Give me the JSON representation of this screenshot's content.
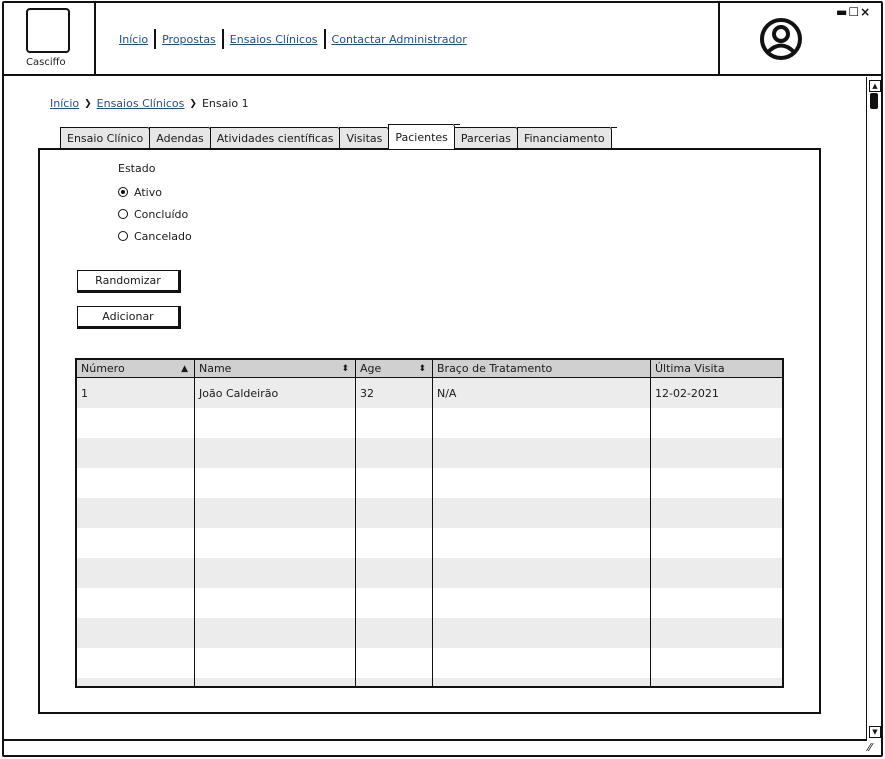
{
  "app": {
    "name": "Casciffo"
  },
  "topnav": {
    "items": [
      {
        "label": "Início"
      },
      {
        "label": "Propostas"
      },
      {
        "label": "Ensaios Clínicos"
      },
      {
        "label": "Contactar Administrador"
      }
    ]
  },
  "window_controls": {
    "label": "▬☐×"
  },
  "breadcrumb": {
    "items": [
      {
        "label": "Início"
      },
      {
        "label": "Ensaios Clínicos"
      },
      {
        "label": "Ensaio 1"
      }
    ],
    "separator": "❯"
  },
  "tabs": [
    {
      "label": "Ensaio Clínico"
    },
    {
      "label": "Adendas"
    },
    {
      "label": "Atividades científicas"
    },
    {
      "label": "Visitas"
    },
    {
      "label": "Pacientes",
      "active": true
    },
    {
      "label": "Parcerias"
    },
    {
      "label": "Financiamento"
    }
  ],
  "status": {
    "title": "Estado",
    "options": [
      {
        "label": "Ativo",
        "selected": true
      },
      {
        "label": "Concluído",
        "selected": false
      },
      {
        "label": "Cancelado",
        "selected": false
      }
    ]
  },
  "buttons": {
    "randomize": "Randomizar",
    "add": "Adicionar"
  },
  "table": {
    "columns": [
      {
        "label": "Número",
        "sort_icon": "▲"
      },
      {
        "label": "Name",
        "sort_icon": "⬍"
      },
      {
        "label": "Age",
        "sort_icon": "⬍"
      },
      {
        "label": "Braço de Tratamento",
        "sort_icon": ""
      },
      {
        "label": "Última Visita",
        "sort_icon": ""
      }
    ],
    "rows": [
      [
        "1",
        "João Caldeirão",
        "32",
        "N/A",
        "12-02-2021"
      ],
      [
        "",
        "",
        "",
        "",
        ""
      ],
      [
        "",
        "",
        "",
        "",
        ""
      ],
      [
        "",
        "",
        "",
        "",
        ""
      ],
      [
        "",
        "",
        "",
        "",
        ""
      ],
      [
        "",
        "",
        "",
        "",
        ""
      ],
      [
        "",
        "",
        "",
        "",
        ""
      ],
      [
        "",
        "",
        "",
        "",
        ""
      ],
      [
        "",
        "",
        "",
        "",
        ""
      ],
      [
        "",
        "",
        "",
        "",
        ""
      ],
      [
        "",
        "",
        "",
        "",
        ""
      ]
    ]
  },
  "icons": {
    "avatar": "user-avatar-icon",
    "breadcrumb_separator": "chevron-right-icon",
    "sort": "sort-icon"
  },
  "colors": {
    "link": "#1f4f8f",
    "table_header": "#d0d0d0",
    "row_stripe": "#ececec"
  }
}
